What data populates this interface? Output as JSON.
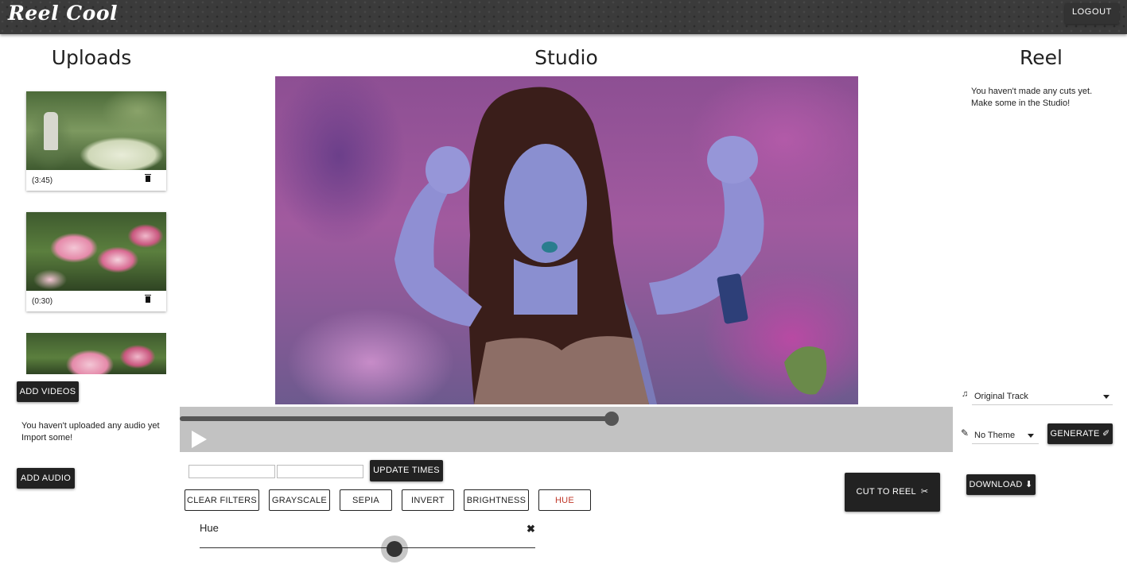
{
  "app": {
    "brand": "Reel Cool",
    "logout_label": "LOGOUT"
  },
  "columns": {
    "uploads_title": "Uploads",
    "studio_title": "Studio",
    "reel_title": "Reel"
  },
  "uploads": {
    "videos": [
      {
        "duration": "(3:45)"
      },
      {
        "duration": "(0:30)"
      },
      {
        "duration": ""
      }
    ],
    "add_videos_label": "ADD VIDEOS",
    "audio_empty_text": "You haven't uploaded any audio yet Import some!",
    "add_audio_label": "ADD AUDIO"
  },
  "studio": {
    "start_time_value": "",
    "end_time_value": "",
    "update_times_label": "UPDATE TIMES",
    "filters": [
      "CLEAR FILTERS",
      "GRAYSCALE",
      "SEPIA",
      "INVERT",
      "BRIGHTNESS",
      "HUE"
    ],
    "active_filter": "HUE",
    "active_filter_color": "#c0392b",
    "cut_to_reel_label": "CUT TO REEL",
    "hue_label": "Hue",
    "hue_value_fraction": 0.58,
    "seek_progress_fraction": 0.56
  },
  "reel": {
    "empty_text_line1": "You haven't made any cuts yet.",
    "empty_text_line2": "Make some in the Studio!",
    "track_select_value": "Original Track",
    "theme_select_value": "No Theme",
    "generate_label": "GENERATE",
    "download_label": "DOWNLOAD"
  },
  "icons": [
    "music-note-icon",
    "brush-icon",
    "magic-wand-icon",
    "download-icon",
    "scissors-icon",
    "trash-icon",
    "play-icon",
    "close-icon"
  ]
}
